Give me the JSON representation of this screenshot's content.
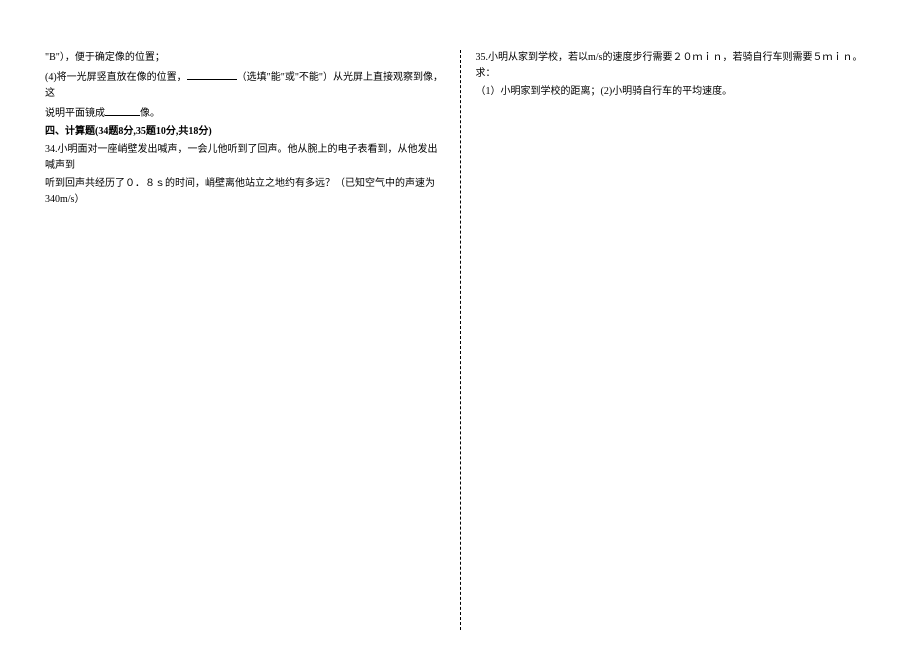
{
  "left_column": {
    "line1_prefix": "\"B\"），便于确定像的位置；",
    "line2_prefix": "(4)将一光屏竖直放在像的位置，",
    "line2_mid": "（选填\"能\"或\"不能\"）从光屏上直接观察到像，这",
    "line3_prefix": "说明平面镜成",
    "line3_suffix": "像。",
    "section_title": "四、计算题(34题8分,35题10分,共18分)",
    "q34_line1": "34.小明面对一座峭壁发出喊声，一会儿他听到了回声。他从腕上的电子表看到，从他发出喊声到",
    "q34_line2": "听到回声共经历了０．８ｓ的时间，峭壁离他站立之地约有多远？（已知空气中的声速为340m/s）"
  },
  "right_column": {
    "q35_line1": "35.小明从家到学校，若以m/s的速度步行需要２０ｍｉｎ，若骑自行车则需要５ｍｉｎ。求：",
    "q35_line2": "（1）小明家到学校的距离；(2)小明骑自行车的平均速度。"
  }
}
